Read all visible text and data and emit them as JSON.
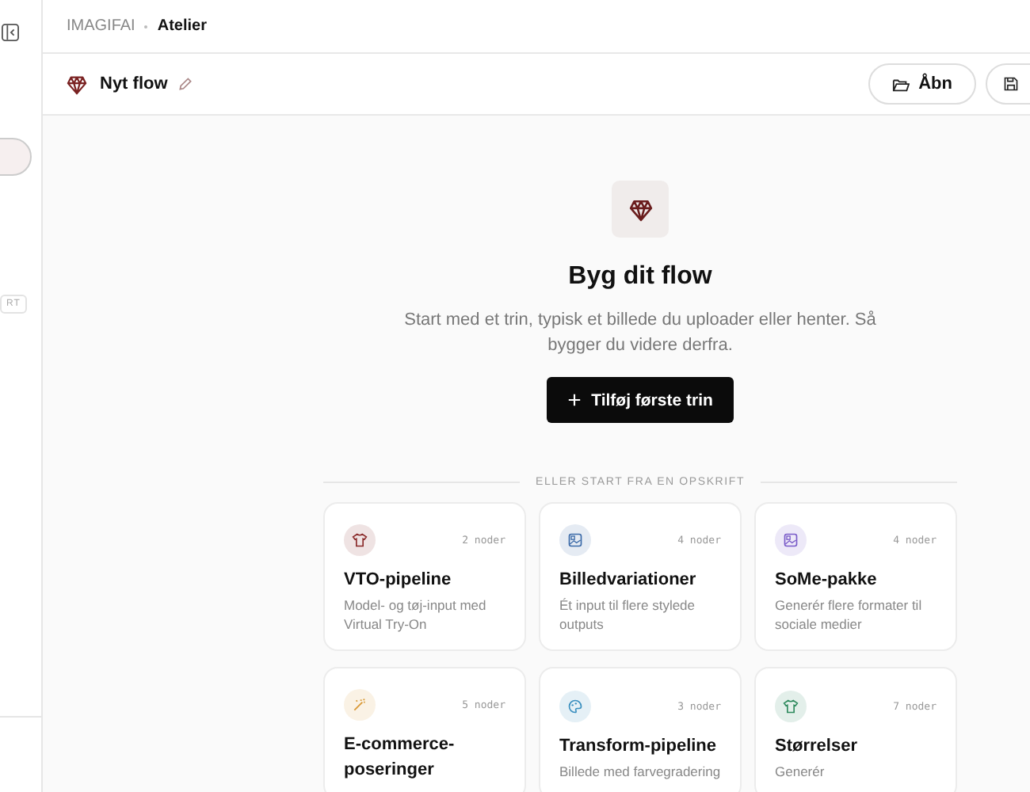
{
  "sidebar": {
    "badge": "RT"
  },
  "breadcrumb": {
    "root": "IMAGIFAI",
    "current": "Atelier"
  },
  "flow_header": {
    "title": "Nyt flow",
    "buttons": [
      {
        "label": "Åbn",
        "kind": "open"
      },
      {
        "kind": "save"
      }
    ]
  },
  "empty_state": {
    "title": "Byg dit flow",
    "description": "Start med et trin, typisk et billede du uploader eller henter. Så bygger du videre derfra.",
    "button": "Tilføj første trin"
  },
  "recipes": {
    "heading": "ELLER START FRA EN OPSKRIFT",
    "items": [
      {
        "title": "VTO-pipeline",
        "count": "2 noder",
        "description": "Model- og tøj-input med Virtual Try-On",
        "kind": "shirt",
        "color": "#8a2a2a"
      },
      {
        "title": "Billedvariationer",
        "count": "4 noder",
        "description": "Ét input til flere stylede outputs",
        "kind": "image",
        "color": "#3b6aa8"
      },
      {
        "title": "SoMe-pakke",
        "count": "4 noder",
        "description": "Generér flere formater til sociale medier",
        "kind": "image",
        "color": "#7a5cc8"
      },
      {
        "title": "E-commerce-poseringer",
        "count": "5 noder",
        "kind": "wand",
        "color": "#d99a3a"
      },
      {
        "title": "Transform-pipeline",
        "count": "3 noder",
        "description": "Billede med farvegradering",
        "kind": "palette",
        "color": "#3a8fbf"
      },
      {
        "title": "Størrelser",
        "count": "7 noder",
        "description": "Generér",
        "kind": "shirt",
        "color": "#2f8a5e"
      }
    ]
  }
}
